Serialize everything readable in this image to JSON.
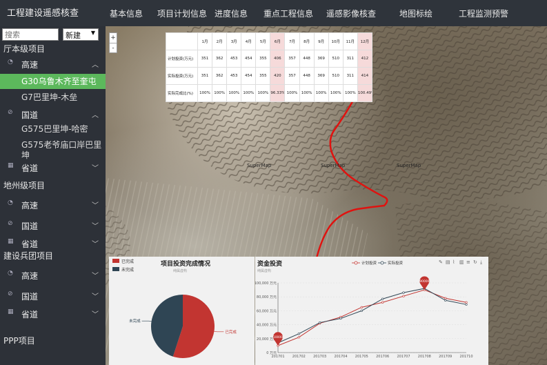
{
  "app_title": "工程建设遥感核查",
  "nav": [
    "基本信息",
    "项目计划信息",
    "进度信息",
    "重点工程信息",
    "遥感影像核查",
    "地图标绘",
    "工程监测预警"
  ],
  "sidebar": {
    "search_placeholder": "搜索",
    "new_select": "新建",
    "section1": "厅本级项目",
    "s1_g1": "高速",
    "s1_sub1": "G30乌鲁木齐至奎屯",
    "s1_sub2": "G7巴里坤-木垒",
    "s1_g2": "国道",
    "s1_sub3": "G575巴里坤-哈密",
    "s1_sub4": "G575老爷庙口岸巴里坤",
    "s1_g3": "省道",
    "section2": "地州级项目",
    "s2_g1": "高速",
    "s2_g2": "国道",
    "s2_g3": "省道",
    "section3": "建设兵团项目",
    "s3_g1": "高速",
    "s3_g2": "国道",
    "s3_g3": "省道",
    "section4": "PPP项目"
  },
  "map": {
    "zoom_in": "+",
    "zoom_out": "-",
    "label1": "SuperMap",
    "label2": "SuperMap",
    "label3": "SuperMap"
  },
  "table": {
    "months": [
      "1月",
      "2月",
      "3月",
      "4月",
      "5月",
      "6月",
      "7月",
      "8月",
      "9月",
      "10月",
      "11月",
      "12月"
    ],
    "rows": [
      {
        "label": "计划投资(万元)",
        "values": [
          "351",
          "362",
          "453",
          "454",
          "355",
          "406",
          "357",
          "448",
          "369",
          "510",
          "311",
          "412"
        ]
      },
      {
        "label": "实际投资(万元)",
        "values": [
          "351",
          "362",
          "453",
          "454",
          "355",
          "420",
          "357",
          "448",
          "369",
          "510",
          "311",
          "414"
        ]
      },
      {
        "label": "实际完成比(%)",
        "values": [
          "100%",
          "100%",
          "100%",
          "100%",
          "100%",
          "96.33%",
          "100%",
          "100%",
          "100%",
          "100%",
          "100%",
          "100.49%"
        ]
      }
    ]
  },
  "pie_panel": {
    "title": "项目投资完成情况",
    "subtitle": "纯属虚构",
    "legend_done": "已完成",
    "legend_undone": "未完成",
    "color_done": "#c23531",
    "color_undone": "#2f4554"
  },
  "line_panel": {
    "title": "资金投资",
    "subtitle": "纯属虚构",
    "legend_plan": "计划投资",
    "legend_actual": "实际投资",
    "color_plan": "#c23531",
    "color_actual": "#2f4554",
    "toolbox_icons": [
      "mark-icon",
      "data-view-icon",
      "line-icon",
      "bar-icon",
      "stack-icon",
      "restore-icon",
      "save-icon"
    ]
  },
  "chart_data": [
    {
      "type": "pie",
      "title": "项目投资完成情况",
      "subtitle": "纯属虚构",
      "categories": [
        "已完成",
        "未完成"
      ],
      "values": [
        55,
        45
      ],
      "legend": "top-left"
    },
    {
      "type": "line",
      "title": "资金投资",
      "subtitle": "纯属虚构",
      "categories": [
        "201701",
        "201702",
        "201703",
        "201704",
        "201705",
        "201706",
        "201707",
        "201708",
        "201709",
        "201710"
      ],
      "ytick_labels": [
        "0 万元",
        "20,000 万元",
        "40,000 万元",
        "60,000 万元",
        "80,000 万元",
        "100,000 万元"
      ],
      "ylim": [
        0,
        100000
      ],
      "series": [
        {
          "name": "计划投资",
          "values": [
            10000,
            22000,
            42000,
            51000,
            65000,
            72000,
            81000,
            90000,
            78000,
            72000
          ]
        },
        {
          "name": "实际投资",
          "values": [
            14000,
            27000,
            43000,
            49000,
            60000,
            77000,
            86000,
            92000,
            75000,
            69000
          ]
        }
      ],
      "markpoints": [
        {
          "series": "计划投资",
          "label": "10000"
        },
        {
          "series": "计划投资",
          "label": "90000"
        }
      ],
      "legend": "top-right"
    }
  ]
}
